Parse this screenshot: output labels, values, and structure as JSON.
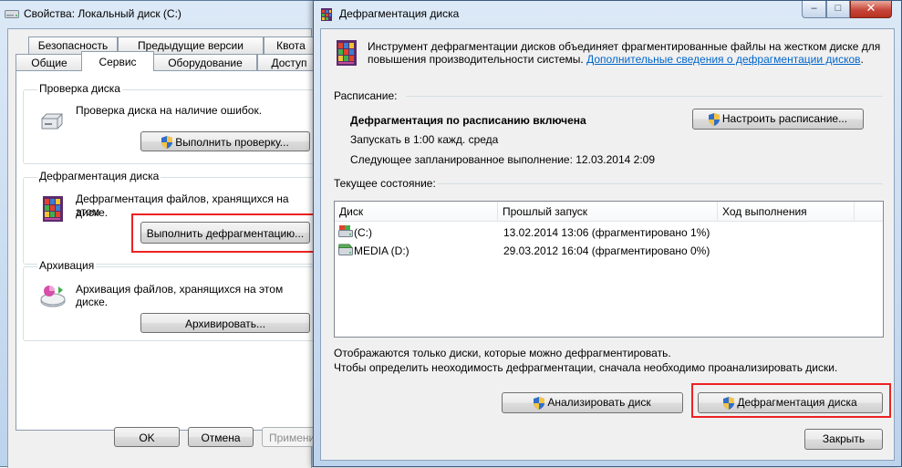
{
  "props": {
    "title": "Свойства: Локальный диск (C:)",
    "tabs_row1": [
      "Безопасность",
      "Предыдущие версии",
      "Квота"
    ],
    "tabs_row2": [
      "Общие",
      "Сервис",
      "Оборудование",
      "Доступ"
    ],
    "active_tab": "Сервис",
    "check": {
      "title": "Проверка диска",
      "desc": "Проверка диска на наличие ошибок.",
      "button": "Выполнить проверку..."
    },
    "defrag": {
      "title": "Дефрагментация диска",
      "desc_line1": "Дефрагментация файлов, хранящихся на этом",
      "desc_line2": "диске.",
      "button": "Выполнить дефрагментацию..."
    },
    "backup": {
      "title": "Архивация",
      "desc": "Архивация файлов, хранящихся на этом диске.",
      "button": "Архивировать..."
    },
    "ok": "OK",
    "cancel": "Отмена",
    "apply": "Примени"
  },
  "defrag_window": {
    "title": "Дефрагментация диска",
    "controls": {
      "minimize": "–",
      "maximize": "□",
      "close": "✕"
    },
    "intro_line1": "Инструмент дефрагментации дисков объединяет фрагментированные файлы на жестком диске для",
    "intro_line2": "повышения производительности системы.",
    "intro_link": "Дополнительные сведения о дефрагментации дисков",
    "intro_end": ".",
    "schedule": {
      "title": "Расписание:",
      "status": "Дефрагментация по расписанию включена",
      "run_at": "Запускать в 1:00 кажд. среда",
      "next_run": "Следующее запланированное выполнение: 12.03.2014 2:09",
      "configure_button": "Настроить расписание..."
    },
    "current": {
      "title": "Текущее состояние:",
      "columns": [
        "Диск",
        "Прошлый запуск",
        "Ход выполнения"
      ],
      "rows": [
        {
          "disk": "(C:)",
          "last_run": "13.02.2014 13:06 (фрагментировано 1%)",
          "progress": ""
        },
        {
          "disk": "MEDIA (D:)",
          "last_run": "29.03.2012 16:04 (фрагментировано 0%)",
          "progress": ""
        }
      ]
    },
    "note_line1": "Отображаются только диски, которые можно дефрагментировать.",
    "note_line2": "Чтобы определить неоходимость  дефрагментации, сначала необходимо проанализировать диски.",
    "analyze_button": "Анализировать диск",
    "defrag_button": "Дефрагментация диска",
    "close_button": "Закрыть"
  },
  "colors": {
    "highlight_box": "#e22222",
    "link": "#0066cc"
  }
}
